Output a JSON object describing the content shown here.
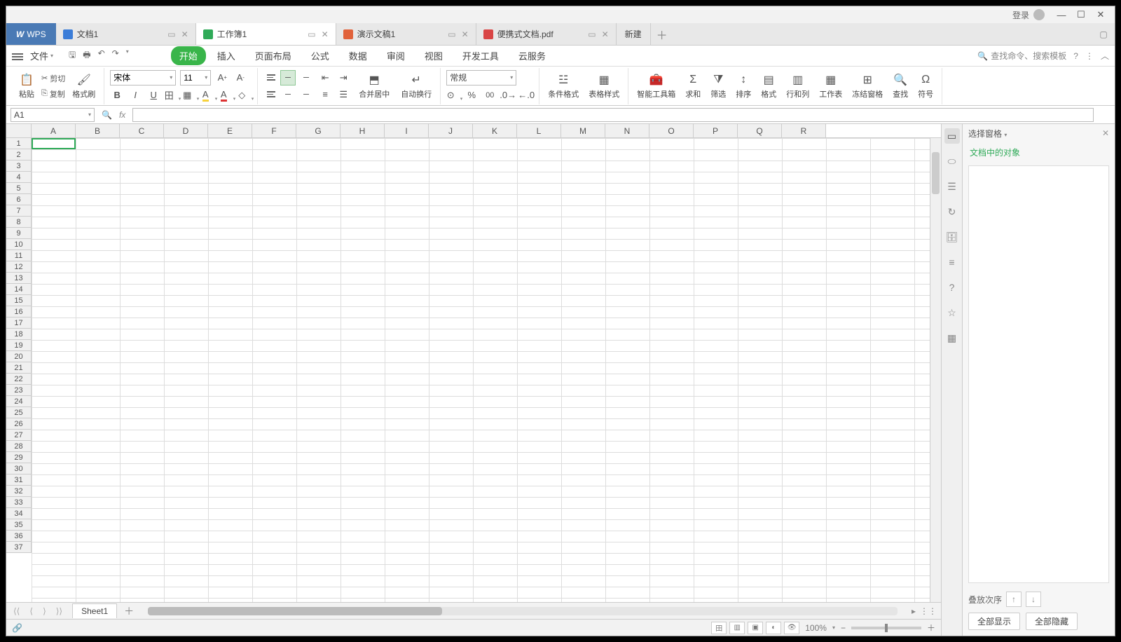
{
  "titlebar": {
    "login": "登录"
  },
  "tabs": {
    "app": "WPS",
    "items": [
      {
        "label": "文档1",
        "type": "word"
      },
      {
        "label": "工作簿1",
        "type": "sheet",
        "active": true
      },
      {
        "label": "演示文稿1",
        "type": "pres"
      },
      {
        "label": "便携式文档.pdf",
        "type": "pdf"
      }
    ],
    "new": "新建"
  },
  "menu": {
    "file": "文件",
    "items": [
      "开始",
      "插入",
      "页面布局",
      "公式",
      "数据",
      "审阅",
      "视图",
      "开发工具",
      "云服务"
    ],
    "activeIndex": 0,
    "search": "查找命令、搜索模板"
  },
  "ribbon": {
    "paste": "粘贴",
    "cut": "剪切",
    "copy": "复制",
    "fmtp": "格式刷",
    "font": "宋体",
    "fontsize": "11",
    "mergecenter": "合并居中",
    "wrap": "自动换行",
    "numfmt": "常规",
    "condfmt": "条件格式",
    "tablestyle": "表格样式",
    "smartbox": "智能工具箱",
    "sum": "求和",
    "filter": "筛选",
    "sort": "排序",
    "format": "格式",
    "rowcol": "行和列",
    "worksheet": "工作表",
    "freeze": "冻结窗格",
    "find": "查找",
    "symbol": "符号"
  },
  "fx": {
    "namebox": "A1"
  },
  "grid": {
    "cols": [
      "A",
      "B",
      "C",
      "D",
      "E",
      "F",
      "G",
      "H",
      "I",
      "J",
      "K",
      "L",
      "M",
      "N",
      "O",
      "P",
      "Q",
      "R"
    ],
    "rows": 37
  },
  "sidepane": {
    "header": "选择窗格",
    "title": "文档中的对象",
    "order": "叠放次序",
    "showall": "全部显示",
    "hideall": "全部隐藏"
  },
  "sheet": {
    "name": "Sheet1"
  },
  "status": {
    "zoom": "100%"
  }
}
